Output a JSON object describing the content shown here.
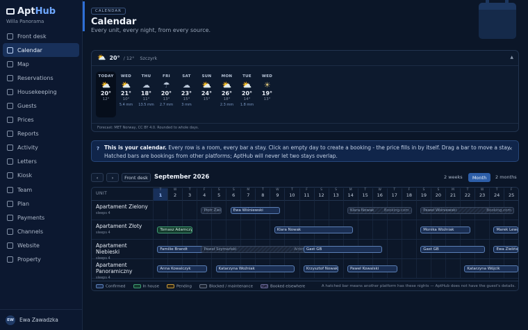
{
  "app": {
    "brand_prefix": "Apt",
    "brand_suffix": "Hub",
    "org": "Willa Panorama"
  },
  "nav": [
    {
      "label": "Front desk",
      "icon": "home-icon"
    },
    {
      "label": "Calendar",
      "icon": "calendar-icon",
      "active": true
    },
    {
      "label": "Map",
      "icon": "map-icon"
    },
    {
      "label": "Reservations",
      "icon": "list-icon"
    },
    {
      "label": "Housekeeping",
      "icon": "broom-icon"
    },
    {
      "label": "Guests",
      "icon": "people-icon"
    },
    {
      "label": "Prices",
      "icon": "tag-icon"
    },
    {
      "label": "Reports",
      "icon": "chart-icon"
    },
    {
      "label": "Activity",
      "icon": "pulse-icon"
    },
    {
      "label": "Letters",
      "icon": "mail-icon"
    },
    {
      "label": "Kiosk",
      "icon": "kiosk-icon"
    },
    {
      "label": "Team",
      "icon": "team-icon"
    },
    {
      "label": "Plan",
      "icon": "flag-icon"
    },
    {
      "label": "Payments",
      "icon": "card-icon"
    },
    {
      "label": "Channels",
      "icon": "link-icon"
    },
    {
      "label": "Website",
      "icon": "globe-icon"
    },
    {
      "label": "Property",
      "icon": "building-icon"
    }
  ],
  "user": {
    "initials": "EW",
    "name": "Ewa Zawadzka"
  },
  "header": {
    "tag": "CALENDAR",
    "title": "Calendar",
    "subtitle": "Every unit, every night, from every source."
  },
  "weather": {
    "now_temp": "20°",
    "now_low": "/ 12°",
    "city": "Szczyrk",
    "days": [
      {
        "name": "TODAY",
        "icon": "sun-cloud-icon",
        "hi": "20°",
        "lo": "12°",
        "mm": ""
      },
      {
        "name": "WED",
        "icon": "sun-cloud-icon",
        "hi": "21°",
        "lo": "10°",
        "mm": "5.4 mm"
      },
      {
        "name": "THU",
        "icon": "cloud-icon",
        "hi": "18°",
        "lo": "11°",
        "mm": "13.5 mm"
      },
      {
        "name": "FRI",
        "icon": "rain-icon",
        "hi": "20°",
        "lo": "13°",
        "mm": "2.7 mm"
      },
      {
        "name": "SAT",
        "icon": "cloud-icon",
        "hi": "23°",
        "lo": "15°",
        "mm": "3 mm"
      },
      {
        "name": "SUN",
        "icon": "sun-cloud-icon",
        "hi": "24°",
        "lo": "15°",
        "mm": ""
      },
      {
        "name": "MON",
        "icon": "sun-cloud-icon",
        "hi": "26°",
        "lo": "18°",
        "mm": "2.3 mm"
      },
      {
        "name": "TUE",
        "icon": "sun-cloud-icon",
        "hi": "20°",
        "lo": "14°",
        "mm": "1.8 mm"
      },
      {
        "name": "WED",
        "icon": "sun-icon",
        "hi": "19°",
        "lo": "13°",
        "mm": ""
      }
    ],
    "footer": "Forecast: MET Norway, CC BY 4.0. Rounded to whole days."
  },
  "info": {
    "q": "?",
    "lead": "This is your calendar.",
    "text": " Every row is a room, every bar a stay. Click an empty day to create a booking - the price fills in by itself. Drag a bar to move a stay. Hatched bars are bookings from other platforms; AptHub will never let two stays overlap.",
    "close": "×"
  },
  "toolbar": {
    "prev": "‹",
    "next": "›",
    "front_desk": "Front desk",
    "month": "September 2026",
    "view_2w": "2 weeks",
    "view_month": "Month",
    "view_2m": "2 months"
  },
  "grid": {
    "unit_header": "UNIT",
    "days": [
      {
        "wd": "T",
        "d": "1",
        "today": true
      },
      {
        "wd": "W",
        "d": "2"
      },
      {
        "wd": "T",
        "d": "3"
      },
      {
        "wd": "F",
        "d": "4"
      },
      {
        "wd": "S",
        "d": "5"
      },
      {
        "wd": "S",
        "d": "6"
      },
      {
        "wd": "M",
        "d": "7"
      },
      {
        "wd": "T",
        "d": "8"
      },
      {
        "wd": "W",
        "d": "9"
      },
      {
        "wd": "T",
        "d": "10"
      },
      {
        "wd": "F",
        "d": "11"
      },
      {
        "wd": "S",
        "d": "12"
      },
      {
        "wd": "S",
        "d": "13"
      },
      {
        "wd": "M",
        "d": "14"
      },
      {
        "wd": "T",
        "d": "15"
      },
      {
        "wd": "W",
        "d": "16"
      },
      {
        "wd": "T",
        "d": "17"
      },
      {
        "wd": "F",
        "d": "18"
      },
      {
        "wd": "S",
        "d": "19"
      },
      {
        "wd": "S",
        "d": "20"
      },
      {
        "wd": "M",
        "d": "21"
      },
      {
        "wd": "T",
        "d": "22"
      },
      {
        "wd": "W",
        "d": "23"
      },
      {
        "wd": "T",
        "d": "24"
      },
      {
        "wd": "F",
        "d": "25"
      }
    ],
    "units": [
      {
        "name": "Apartament Zielony",
        "sleeps": "sleeps 4",
        "stays": [
          {
            "guest": "Piotr Zieliński",
            "start": 3.3,
            "end": 4.7,
            "kind": "ext"
          },
          {
            "guest": "Ewa Wiśniewski",
            "start": 5.3,
            "end": 8.7,
            "kind": "booked"
          },
          {
            "guest": "Klara Nowak",
            "source": "Booking.com",
            "start": 13.3,
            "end": 17.7,
            "kind": "ext"
          },
          {
            "guest": "Paweł Wiśniewski",
            "source": "Booking.com",
            "start": 18.3,
            "end": 24.7,
            "kind": "ext"
          }
        ]
      },
      {
        "name": "Apartament Złoty",
        "sleeps": "sleeps 4",
        "stays": [
          {
            "guest": "Tomasz Adamczyk",
            "start": 0.3,
            "end": 2.7,
            "kind": "inhouse"
          },
          {
            "guest": "Klara Nowak",
            "start": 8.3,
            "end": 13.7,
            "kind": "booked"
          },
          {
            "guest": "Monika Woźniak",
            "start": 18.3,
            "end": 21.7,
            "kind": "booked"
          },
          {
            "guest": "Marek Lewandowski",
            "start": 23.3,
            "end": 25.5,
            "kind": "booked"
          }
        ]
      },
      {
        "name": "Apartament Niebieski",
        "sleeps": "sleeps 4",
        "stays": [
          {
            "guest": "Familie Brandt",
            "start": 0.3,
            "end": 3.7,
            "kind": "booked"
          },
          {
            "guest": "Paweł Szymański",
            "source": "Airbnb",
            "start": 3.3,
            "end": 10.7,
            "kind": "ext"
          },
          {
            "guest": "Gast GB",
            "start": 10.3,
            "end": 15.7,
            "kind": "booked"
          },
          {
            "guest": "Gast GB",
            "start": 18.3,
            "end": 22.7,
            "kind": "booked"
          },
          {
            "guest": "Ewa Zielińska",
            "start": 23.3,
            "end": 25.5,
            "kind": "booked"
          }
        ]
      },
      {
        "name": "Apartament Panoramiczny",
        "sleeps": "sleeps 4",
        "stays": [
          {
            "guest": "Anna Kowalczyk",
            "start": 0.3,
            "end": 3.7,
            "kind": "booked"
          },
          {
            "guest": "Katarzyna Woźniak",
            "start": 4.3,
            "end": 9.7,
            "kind": "booked"
          },
          {
            "guest": "Krzysztof Nowak",
            "start": 10.3,
            "end": 12.7,
            "kind": "booked"
          },
          {
            "guest": "Paweł Kowalski",
            "start": 13.3,
            "end": 16.7,
            "kind": "booked"
          },
          {
            "guest": "Katarzyna Wójcik",
            "start": 21.3,
            "end": 25.5,
            "kind": "booked"
          }
        ]
      }
    ],
    "legend": [
      {
        "label": "Confirmed",
        "kind": "booked"
      },
      {
        "label": "In house",
        "kind": "inhouse"
      },
      {
        "label": "Pending",
        "kind": "pending"
      },
      {
        "label": "Blocked / maintenance",
        "kind": "blocked"
      },
      {
        "label": "Booked elsewhere",
        "kind": "ext"
      }
    ],
    "legend_note": "A hatched bar means another platform has these nights — AptHub does not have the guest's details."
  }
}
